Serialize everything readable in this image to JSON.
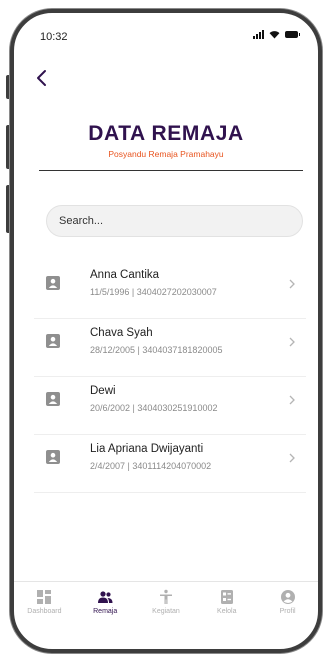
{
  "status_bar": {
    "time": "10:32"
  },
  "header": {
    "title": "DATA REMAJA",
    "subtitle": "Posyandu Remaja Pramahayu"
  },
  "search": {
    "placeholder": "Search..."
  },
  "remaja": [
    {
      "name": "Anna Cantika",
      "meta": "11/5/1996 | 3404027202030007"
    },
    {
      "name": "Chava Syah",
      "meta": "28/12/2005 | 3404037181820005"
    },
    {
      "name": "Dewi",
      "meta": "20/6/2002 | 3404030251910002"
    },
    {
      "name": "Lia Apriana Dwijayanti",
      "meta": "2/4/2007 | 3401114204070002"
    }
  ],
  "bottom_nav": [
    {
      "label": "Dashboard",
      "icon": "dashboard-icon",
      "active": false
    },
    {
      "label": "Remaja",
      "icon": "users-icon",
      "active": true
    },
    {
      "label": "Kegiatan",
      "icon": "person-activity-icon",
      "active": false
    },
    {
      "label": "Kelola",
      "icon": "manage-icon",
      "active": false
    },
    {
      "label": "Profil",
      "icon": "profile-icon",
      "active": false
    }
  ],
  "colors": {
    "primary": "#30124e",
    "accent": "#e8541f",
    "muted": "#b0b0b0"
  }
}
